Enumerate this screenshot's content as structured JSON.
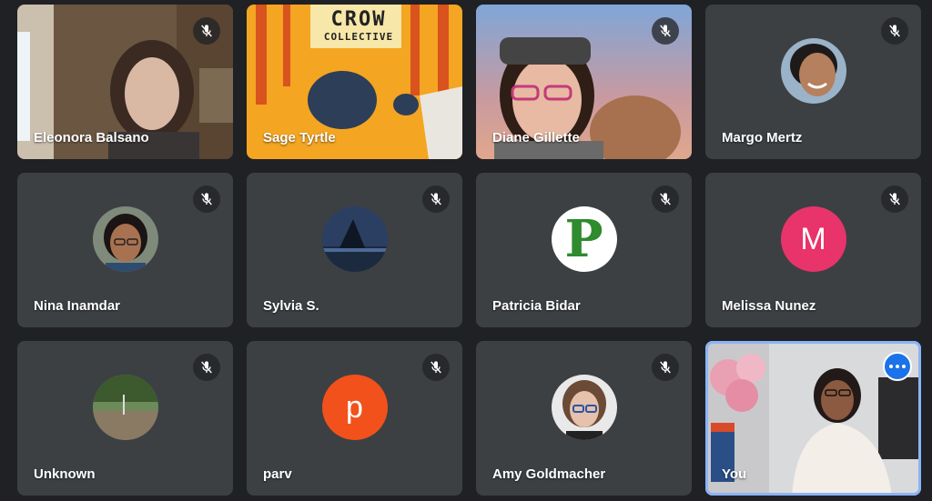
{
  "participants": [
    {
      "name": "Eleonora Balsano",
      "type": "video",
      "muted": true
    },
    {
      "name": "Sage Tyrtle",
      "type": "video",
      "muted": false
    },
    {
      "name": "Diane Gillette",
      "type": "video",
      "muted": true
    },
    {
      "name": "Margo Mertz",
      "type": "avatar",
      "muted": true
    },
    {
      "name": "Nina Inamdar",
      "type": "avatar",
      "muted": true
    },
    {
      "name": "Sylvia S.",
      "type": "avatar",
      "muted": true
    },
    {
      "name": "Patricia Bidar",
      "type": "avatar",
      "muted": true
    },
    {
      "name": "Melissa Nunez",
      "type": "letter",
      "letter": "M",
      "color": "#e8336b",
      "muted": true
    },
    {
      "name": "Unknown",
      "type": "avatar",
      "muted": true
    },
    {
      "name": "parv",
      "type": "letter",
      "letter": "p",
      "color": "#f2511b",
      "muted": true
    },
    {
      "name": "Amy Goldmacher",
      "type": "avatar",
      "muted": true
    },
    {
      "name": "You",
      "type": "video",
      "muted": false
    }
  ],
  "sage_video": {
    "poster_line1": "CROW",
    "poster_line2": "COLLECTIVE"
  },
  "patricia_avatar_letter": "P",
  "icons": {
    "mute": "mic-off-icon",
    "more": "more-options-icon"
  }
}
